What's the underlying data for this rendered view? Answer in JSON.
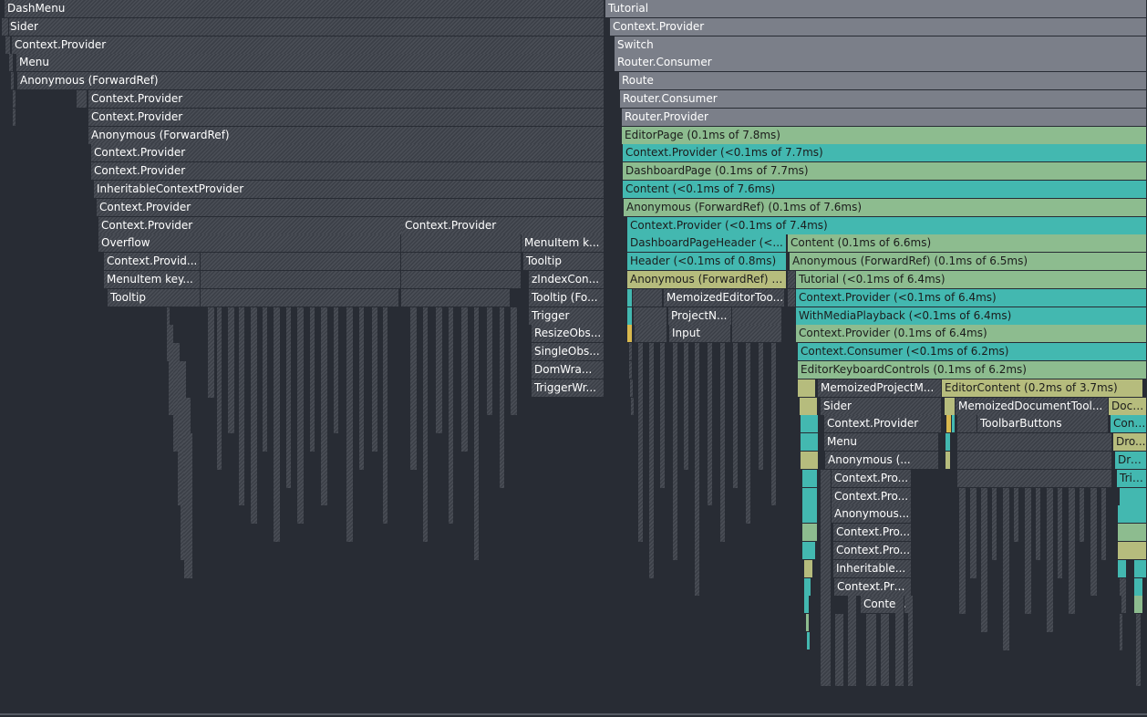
{
  "flamegraph": {
    "labels": [
      "DashMenu",
      "Sider",
      "Context.Provider",
      "Menu",
      "Anonymous (ForwardRef)",
      "Context.Provider",
      "Context.Provider",
      "Anonymous (ForwardRef)",
      "Context.Provider",
      "Context.Provider",
      "InheritableContextProvider",
      "Context.Provider",
      "Context.Provider",
      "Context.Provider",
      "Overflow",
      "MenuItem k...",
      "Context.Provid...",
      "Tooltip",
      "MenuItem key...",
      "zIndexCon...",
      "Tooltip",
      "Tooltip (Fo...",
      "Trigger",
      "ResizeObs...",
      "SingleObs...",
      "DomWra...",
      "TriggerWr...",
      "Tutorial",
      "Context.Provider",
      "Switch",
      "Router.Consumer",
      "Route",
      "Router.Consumer",
      "Router.Provider",
      "EditorPage (0.1ms of 7.8ms)",
      "Context.Provider (<0.1ms of 7.7ms)",
      "DashboardPage (0.1ms of 7.7ms)",
      "Content (<0.1ms of 7.6ms)",
      "Anonymous (ForwardRef) (0.1ms of 7.6ms)",
      "Context.Provider (<0.1ms of 7.4ms)",
      "DashboardPageHeader (<...",
      "Content (0.1ms of 6.6ms)",
      "Header (<0.1ms of 0.8ms)",
      "Anonymous (ForwardRef) (0.1ms of 6.5ms)",
      "Anonymous (ForwardRef) (...",
      "Tutorial (<0.1ms of 6.4ms)",
      "MemoizedEditorToo...",
      "Context.Provider (<0.1ms of 6.4ms)",
      "ProjectN...",
      "WithMediaPlayback (<0.1ms of 6.4ms)",
      "Input",
      "Context.Provider (0.1ms of 6.4ms)",
      "Context.Consumer (<0.1ms of 6.2ms)",
      "EditorKeyboardControls (0.1ms of 6.2ms)",
      "MemoizedProjectM...",
      "EditorContent (0.2ms of 3.7ms)",
      "Sider",
      "MemoizedDocumentTool...",
      "Docu...",
      "Context.Provider",
      "ToolbarButtons",
      "Cont...",
      "Menu",
      "Dro...",
      "Anonymous (...",
      "Dro...",
      "Context.Pro...",
      "Trig...",
      "Context.Pro...",
      "Anonymous...",
      "Context.Pro...",
      "Context.Pro...",
      "Inheritable...",
      "Context.Pro...",
      "Conte..."
    ]
  }
}
